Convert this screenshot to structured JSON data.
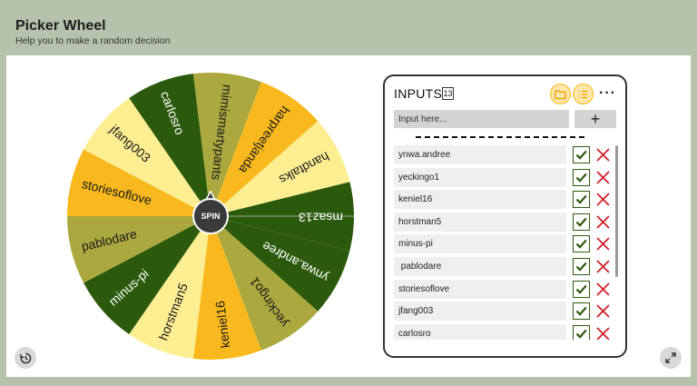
{
  "app": {
    "title": "Picker Wheel",
    "subtitle": "Help you to make a random decision"
  },
  "wheel": {
    "spin_label": "SPIN",
    "segments": [
      {
        "label": "msaz13",
        "color": "#2c5a0d",
        "text_color": "#ffffff"
      },
      {
        "label": "ynwa.andree",
        "color": "#2c5a0d",
        "text_color": "#ffffff"
      },
      {
        "label": "yeckingo1",
        "color": "#aaa83f",
        "text_color": "#1a1a1a"
      },
      {
        "label": "keniel16",
        "color": "#f9b91e",
        "text_color": "#1a1a1a"
      },
      {
        "label": "horstman5",
        "color": "#fdee92",
        "text_color": "#1a1a1a"
      },
      {
        "label": "minus-pi",
        "color": "#2c5a0d",
        "text_color": "#ffffff"
      },
      {
        "label": "pablodare",
        "color": "#aaa83f",
        "text_color": "#1a1a1a"
      },
      {
        "label": "storiesoflove",
        "color": "#f9b91e",
        "text_color": "#1a1a1a"
      },
      {
        "label": "jfang003",
        "color": "#fdee92",
        "text_color": "#1a1a1a"
      },
      {
        "label": "carlosro",
        "color": "#2c5a0d",
        "text_color": "#ffffff"
      },
      {
        "label": "mimismartypants",
        "color": "#aaa83f",
        "text_color": "#1a1a1a"
      },
      {
        "label": "harpreetjanda",
        "color": "#f9b91e",
        "text_color": "#1a1a1a"
      },
      {
        "label": "handtalks",
        "color": "#fdee92",
        "text_color": "#1a1a1a"
      }
    ]
  },
  "inputs": {
    "title": "INPUTS",
    "count": "13",
    "placeholder": "Input here...",
    "add_label": "+",
    "more_label": "···",
    "items": [
      {
        "label": "ynwa.andree"
      },
      {
        "label": "yeckingo1"
      },
      {
        "label": "keniel16"
      },
      {
        "label": "horstman5"
      },
      {
        "label": "minus-pi"
      },
      {
        "label": " pablodare"
      },
      {
        "label": "storiesoflove"
      },
      {
        "label": "jfang003"
      },
      {
        "label": "carlosro"
      }
    ]
  },
  "colors": {
    "accent": "#f9b91e",
    "check": "#2c5a0d",
    "cross": "#d0202a",
    "background": "#b7c2ad"
  },
  "icons": {
    "history": "history-icon",
    "fullscreen": "expand-icon",
    "folder": "folder-icon",
    "list": "list-icon",
    "more": "more-icon"
  }
}
